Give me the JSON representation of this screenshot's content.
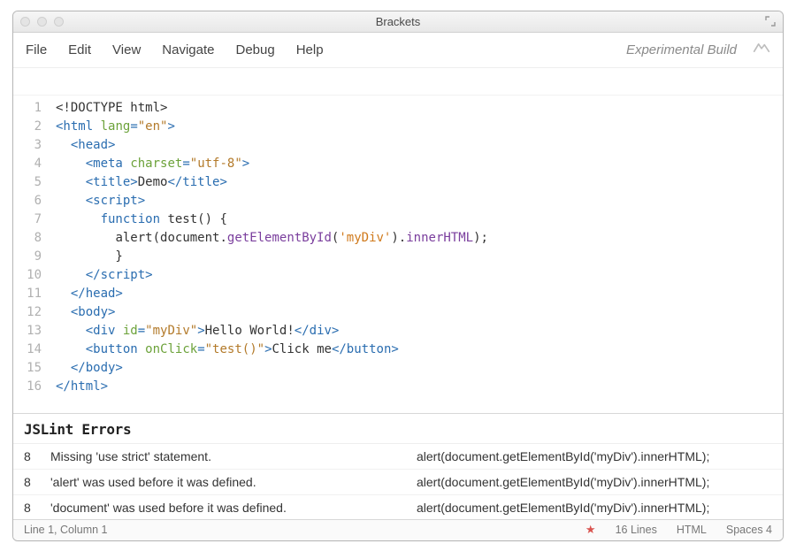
{
  "window": {
    "title": "Brackets"
  },
  "menu": {
    "items": [
      "File",
      "Edit",
      "View",
      "Navigate",
      "Debug",
      "Help"
    ],
    "experimental": "Experimental Build"
  },
  "code": {
    "lines": [
      [
        [
          "c-plain",
          "<!DOCTYPE html>"
        ]
      ],
      [
        [
          "c-tag",
          "<html"
        ],
        [
          "c-plain",
          " "
        ],
        [
          "c-attr",
          "lang"
        ],
        [
          "c-tag",
          "="
        ],
        [
          "c-str",
          "\"en\""
        ],
        [
          "c-tag",
          ">"
        ]
      ],
      [
        [
          "c-plain",
          "  "
        ],
        [
          "c-tag",
          "<head>"
        ]
      ],
      [
        [
          "c-plain",
          "    "
        ],
        [
          "c-tag",
          "<meta"
        ],
        [
          "c-plain",
          " "
        ],
        [
          "c-attr",
          "charset"
        ],
        [
          "c-tag",
          "="
        ],
        [
          "c-str",
          "\"utf-8\""
        ],
        [
          "c-tag",
          ">"
        ]
      ],
      [
        [
          "c-plain",
          "    "
        ],
        [
          "c-tag",
          "<title>"
        ],
        [
          "c-plain",
          "Demo"
        ],
        [
          "c-tag",
          "</title>"
        ]
      ],
      [
        [
          "c-plain",
          "    "
        ],
        [
          "c-tag",
          "<script>"
        ]
      ],
      [
        [
          "c-plain",
          "      "
        ],
        [
          "c-kw",
          "function"
        ],
        [
          "c-plain",
          " "
        ],
        [
          "c-fn",
          "test"
        ],
        [
          "c-plain",
          "() {"
        ]
      ],
      [
        [
          "c-plain",
          "        "
        ],
        [
          "c-fn",
          "alert"
        ],
        [
          "c-plain",
          "("
        ],
        [
          "c-fn",
          "document"
        ],
        [
          "c-plain",
          "."
        ],
        [
          "c-jsprop",
          "getElementById"
        ],
        [
          "c-plain",
          "("
        ],
        [
          "c-jsstr",
          "'myDiv'"
        ],
        [
          "c-plain",
          ")."
        ],
        [
          "c-jsprop",
          "innerHTML"
        ],
        [
          "c-plain",
          ");"
        ]
      ],
      [
        [
          "c-plain",
          "        }"
        ]
      ],
      [
        [
          "c-plain",
          "    "
        ],
        [
          "c-tag",
          "</script>"
        ]
      ],
      [
        [
          "c-plain",
          "  "
        ],
        [
          "c-tag",
          "</head>"
        ]
      ],
      [
        [
          "c-plain",
          "  "
        ],
        [
          "c-tag",
          "<body>"
        ]
      ],
      [
        [
          "c-plain",
          "    "
        ],
        [
          "c-tag",
          "<div"
        ],
        [
          "c-plain",
          " "
        ],
        [
          "c-attr",
          "id"
        ],
        [
          "c-tag",
          "="
        ],
        [
          "c-str",
          "\"myDiv\""
        ],
        [
          "c-tag",
          ">"
        ],
        [
          "c-plain",
          "Hello World!"
        ],
        [
          "c-tag",
          "</div>"
        ]
      ],
      [
        [
          "c-plain",
          "    "
        ],
        [
          "c-tag",
          "<button"
        ],
        [
          "c-plain",
          " "
        ],
        [
          "c-attr",
          "onClick"
        ],
        [
          "c-tag",
          "="
        ],
        [
          "c-str",
          "\"test()\""
        ],
        [
          "c-tag",
          ">"
        ],
        [
          "c-plain",
          "Click me"
        ],
        [
          "c-tag",
          "</button>"
        ]
      ],
      [
        [
          "c-plain",
          "  "
        ],
        [
          "c-tag",
          "</body>"
        ]
      ],
      [
        [
          "c-tag",
          "</html>"
        ]
      ]
    ]
  },
  "panel": {
    "title": "JSLint Errors",
    "rows": [
      {
        "line": "8",
        "msg": "Missing 'use strict' statement.",
        "ev": "alert(document.getElementById('myDiv').innerHTML);"
      },
      {
        "line": "8",
        "msg": "'alert' was used before it was defined.",
        "ev": "alert(document.getElementById('myDiv').innerHTML);"
      },
      {
        "line": "8",
        "msg": "'document' was used before it was defined.",
        "ev": "alert(document.getElementById('myDiv').innerHTML);"
      }
    ]
  },
  "status": {
    "cursor": "Line 1, Column 1",
    "lines": "16 Lines",
    "mode": "HTML",
    "indent": "Spaces 4"
  }
}
